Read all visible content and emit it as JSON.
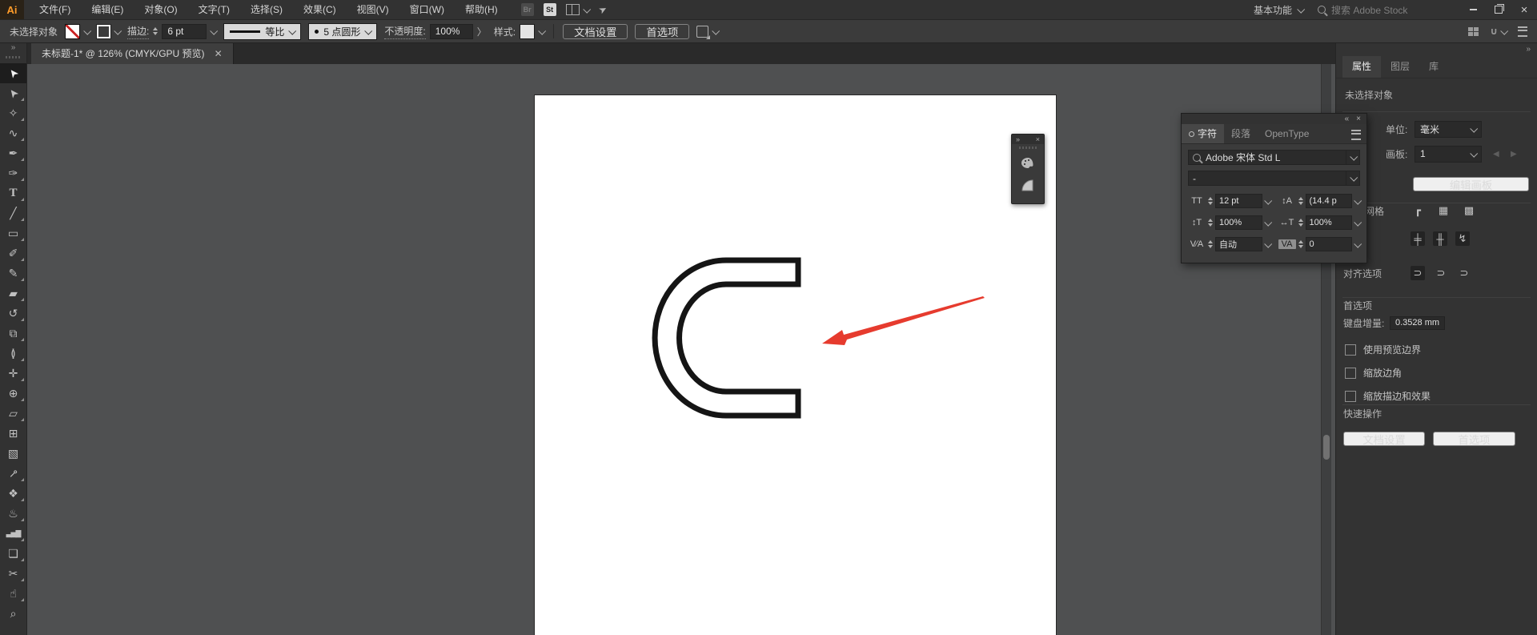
{
  "colors": {
    "arrow_red": "#e63b2e",
    "logo_orange": "#ff9c2a",
    "c_stroke": "#151515"
  },
  "menubar": {
    "logo": "Ai",
    "menus": [
      {
        "name": "menu-file",
        "label": "文件(F)"
      },
      {
        "name": "menu-edit",
        "label": "编辑(E)"
      },
      {
        "name": "menu-object",
        "label": "对象(O)"
      },
      {
        "name": "menu-type",
        "label": "文字(T)"
      },
      {
        "name": "menu-select",
        "label": "选择(S)"
      },
      {
        "name": "menu-effect",
        "label": "效果(C)"
      },
      {
        "name": "menu-view",
        "label": "视图(V)"
      },
      {
        "name": "menu-window",
        "label": "窗口(W)"
      },
      {
        "name": "menu-help",
        "label": "帮助(H)"
      }
    ],
    "bridge_icon": "Br",
    "stock_icon": "St",
    "workspace": "基本功能",
    "search_placeholder": "搜索 Adobe Stock",
    "close_glyph": "×"
  },
  "controlbar": {
    "no_selection": "未选择对象",
    "stroke_label": "描边:",
    "stroke_weight": "6 pt",
    "profile_label": "等比",
    "brush_label": "5 点圆形",
    "opacity_label": "不透明度:",
    "opacity_value": "100%",
    "opacity_more": "〉",
    "style_label": "样式:",
    "doc_setup": "文档设置",
    "preferences": "首选项"
  },
  "tabbar": {
    "doc_title": "未标题-1* @ 126% (CMYK/GPU 预览)",
    "close_glyph": "✕"
  },
  "toolbar": {
    "collapse_glyph": "»",
    "tools": [
      {
        "name": "selection-tool",
        "glyph": "➤",
        "cls": "rot-nw",
        "active": true
      },
      {
        "name": "direct-selection-tool",
        "glyph": "➤",
        "cls": "rot-nw",
        "fly": true
      },
      {
        "name": "magic-wand-tool",
        "glyph": "✧",
        "fly": true
      },
      {
        "name": "lasso-tool",
        "glyph": "∿",
        "fly": true
      },
      {
        "name": "pen-tool",
        "glyph": "✒",
        "fly": true
      },
      {
        "name": "curvature-tool",
        "glyph": "✑",
        "fly": true
      },
      {
        "name": "type-tool",
        "glyph": "T",
        "cls": "serif",
        "fly": true
      },
      {
        "name": "line-segment-tool",
        "glyph": "╱",
        "fly": true
      },
      {
        "name": "rectangle-tool",
        "glyph": "▭",
        "fly": true
      },
      {
        "name": "paintbrush-tool",
        "glyph": "✐",
        "fly": true
      },
      {
        "name": "shaper-pencil-tool",
        "glyph": "✎",
        "fly": true
      },
      {
        "name": "eraser-tool",
        "glyph": "▰",
        "fly": true
      },
      {
        "name": "rotate-tool",
        "glyph": "↺",
        "fly": true
      },
      {
        "name": "scale-tool",
        "glyph": "⧉",
        "fly": true
      },
      {
        "name": "width-tool",
        "glyph": "≬",
        "fly": true
      },
      {
        "name": "free-transform-tool",
        "glyph": "✛",
        "fly": true
      },
      {
        "name": "shape-builder-tool",
        "glyph": "⊕",
        "fly": true
      },
      {
        "name": "perspective-grid-tool",
        "glyph": "▱",
        "fly": true
      },
      {
        "name": "mesh-tool",
        "glyph": "⊞"
      },
      {
        "name": "gradient-tool",
        "glyph": "▧"
      },
      {
        "name": "eyedropper-tool",
        "glyph": "⊸",
        "cls": "rot-45",
        "fly": true
      },
      {
        "name": "blend-tool",
        "glyph": "❖",
        "fly": true
      },
      {
        "name": "symbol-sprayer-tool",
        "glyph": "♨",
        "fly": true
      },
      {
        "name": "column-graph-tool",
        "glyph": "▃▅▇",
        "cls": "small",
        "fly": true
      },
      {
        "name": "artboard-tool",
        "glyph": "❏",
        "fly": true
      },
      {
        "name": "slice-tool",
        "glyph": "✂",
        "fly": true
      },
      {
        "name": "hand-tool",
        "glyph": "☝",
        "fly": true
      },
      {
        "name": "zoom-tool",
        "glyph": "⌕"
      }
    ]
  },
  "minipanel": {
    "collapse_glyph": "»",
    "close_glyph": "×"
  },
  "char_panel": {
    "collapse_glyph": "«",
    "close_glyph": "×",
    "tabs": {
      "character": "字符",
      "paragraph": "段落",
      "opentype": "OpenType"
    },
    "font_name": "Adobe 宋体 Std L",
    "font_style": "-",
    "icons": {
      "font_size": "TT",
      "leading": "↕A",
      "v_scale": "↕T",
      "h_scale": "↔T",
      "kerning": "V∕A",
      "tracking": "VA"
    },
    "values": {
      "font_size": "12 pt",
      "leading": "(14.4 p",
      "v_scale": "100%",
      "h_scale": "100%",
      "kerning": "自动",
      "tracking": "0"
    }
  },
  "dock": {
    "collapse_glyph": "»",
    "tabs": {
      "properties": "属性",
      "layers": "图层",
      "libraries": "库"
    },
    "no_selection": "未选择对象",
    "unit_label": "单位:",
    "unit_value": "毫米",
    "artboard_label": "画板:",
    "artboard_value": "1",
    "prev_glyph": "◀",
    "next_glyph": "▶",
    "edit_artboard": "编辑画板",
    "grid_label": "网格",
    "grid_icons": [
      {
        "name": "ruler-icon",
        "glyph": "┏"
      },
      {
        "name": "grid-icon",
        "glyph": "▦"
      },
      {
        "name": "transparency-grid-icon",
        "glyph": "▩"
      }
    ],
    "snap_icons": [
      {
        "name": "snap-grid-icon",
        "glyph": "╪",
        "cls": "dark"
      },
      {
        "name": "snap-pixel-icon",
        "glyph": "╫",
        "cls": "dark"
      },
      {
        "name": "snap-point-icon",
        "glyph": "↯",
        "cls": "dark"
      }
    ],
    "align_label": "对齐选项",
    "align_icons": [
      {
        "name": "align-grid-magnet-icon",
        "glyph": "⊃",
        "cls": "dark"
      },
      {
        "name": "align-glyph-magnet-icon",
        "glyph": "⊃"
      },
      {
        "name": "align-point-magnet-icon",
        "glyph": "⊃"
      }
    ],
    "prefs_label": "首选项",
    "keyboard_label": "键盘增量:",
    "keyboard_value": "0.3528 mm",
    "checkboxes": [
      "使用预览边界",
      "缩放边角",
      "缩放描边和效果"
    ],
    "quick_label": "快速操作",
    "quick_doc_setup": "文档设置",
    "quick_preferences": "首选项"
  }
}
